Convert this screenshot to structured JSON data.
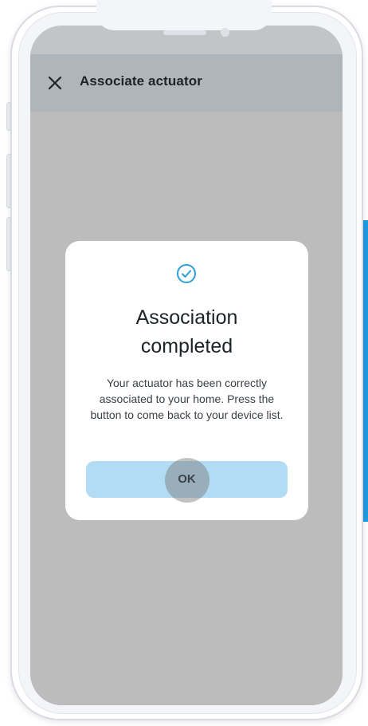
{
  "appbar": {
    "title": "Associate actuator",
    "close_icon": "close-icon"
  },
  "dialog": {
    "icon": "check-circle-icon",
    "title": "Association\ncompleted",
    "message": "Your actuator has been correctly associated to your home. Press the button to come back to your device list.",
    "ok_label": "OK"
  },
  "colors": {
    "accent": "#2a9fd6",
    "button_bg": "#b2dcf3",
    "overlay": "#bcbcbc",
    "appbar_bg": "#aeb6bb"
  }
}
